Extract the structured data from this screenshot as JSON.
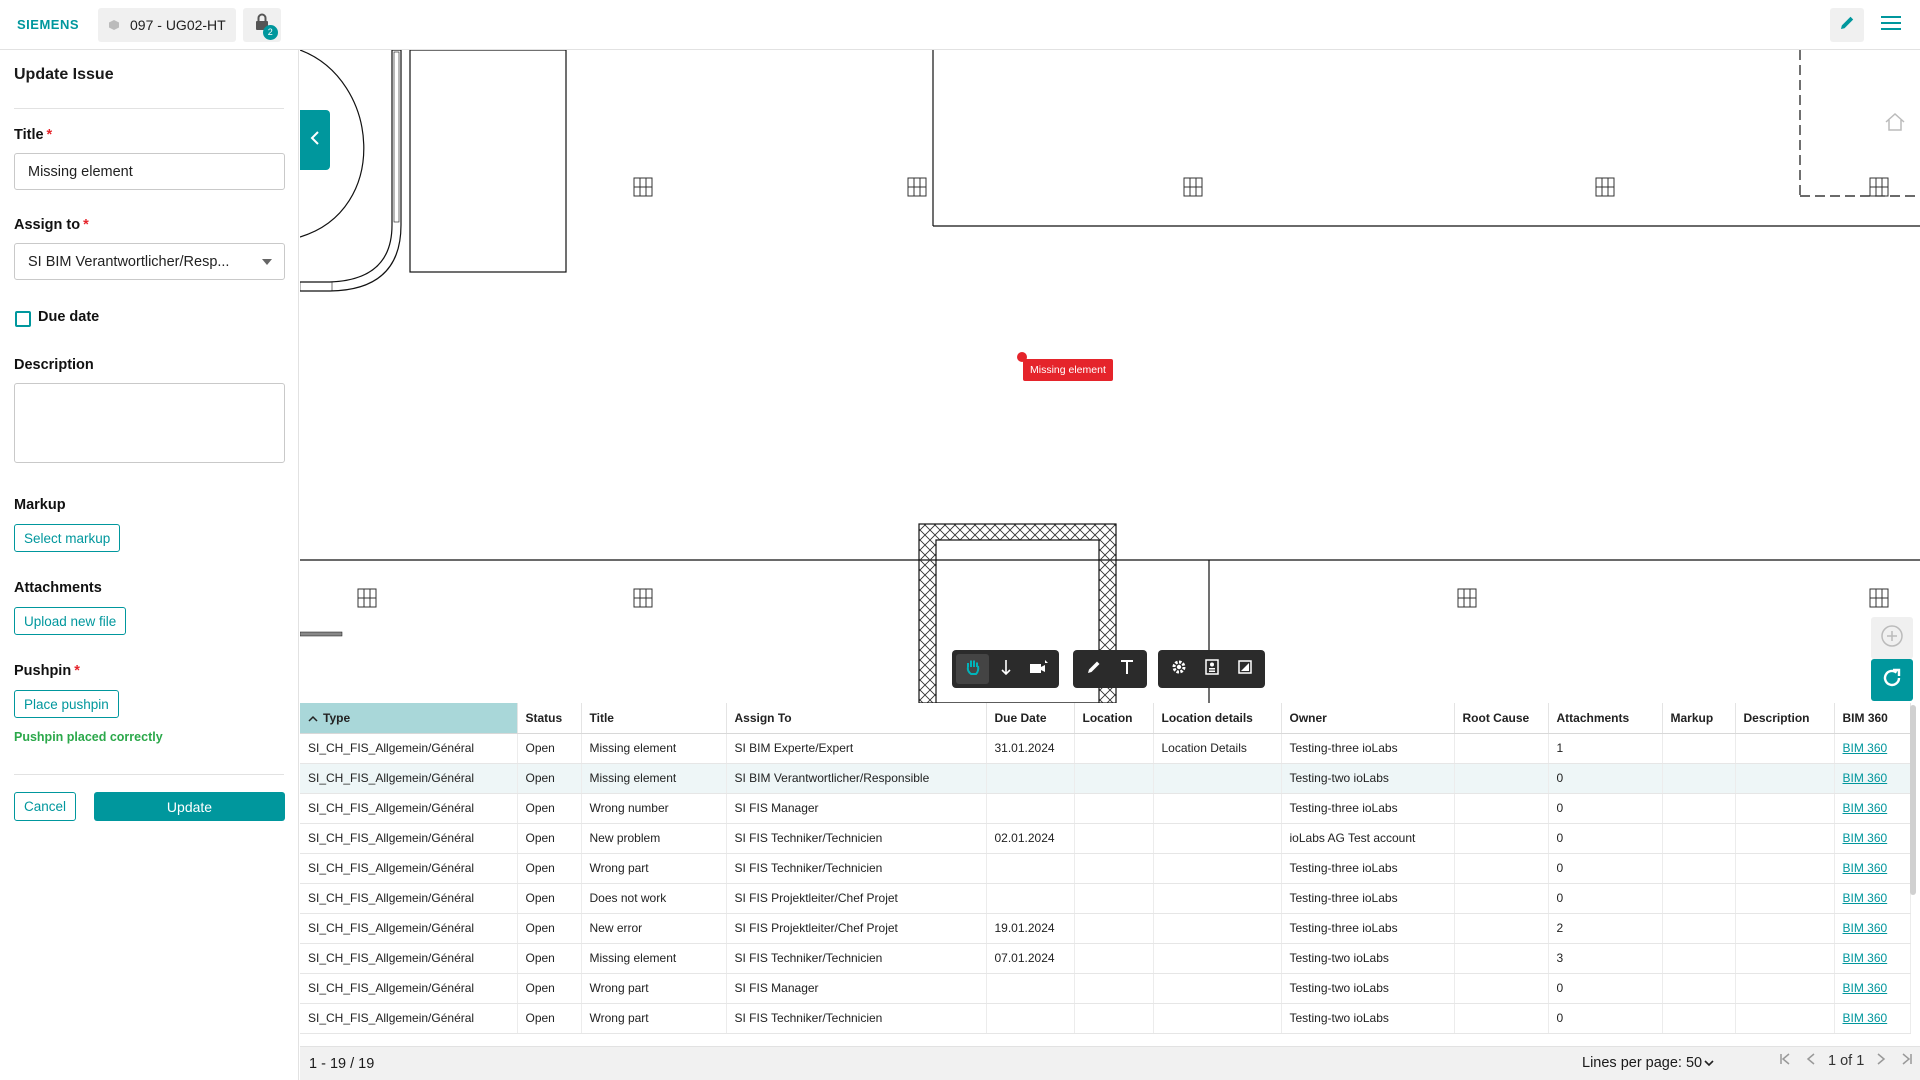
{
  "topbar": {
    "brand": "SIEMENS",
    "model_name": "097 - UG02-HT",
    "lock_badge": "2"
  },
  "panel": {
    "title": "Update Issue",
    "title_label": "Title",
    "title_value": "Missing element",
    "assign_label": "Assign to",
    "assign_value": "SI BIM Verantwortlicher/Resp...",
    "due_date_label": "Due date",
    "description_label": "Description",
    "markup_label": "Markup",
    "select_markup": "Select markup",
    "attachments_label": "Attachments",
    "upload_file": "Upload new file",
    "pushpin_label": "Pushpin",
    "place_pushpin": "Place pushpin",
    "pushpin_status": "Pushpin placed correctly",
    "cancel": "Cancel",
    "update": "Update",
    "required_mark": "*"
  },
  "viewer": {
    "issue_label": "Missing element"
  },
  "table": {
    "columns": [
      "Type",
      "Status",
      "Title",
      "Assign To",
      "Due Date",
      "Location",
      "Location details",
      "Owner",
      "Root Cause",
      "Attachments",
      "Markup",
      "Description",
      "BIM 360"
    ],
    "rows": [
      [
        "SI_CH_FIS_Allgemein/Général",
        "Open",
        "Missing element",
        "SI BIM Experte/Expert",
        "31.01.2024",
        "",
        "Location Details",
        "Testing-three ioLabs",
        "",
        "1",
        "",
        "",
        "BIM 360"
      ],
      [
        "SI_CH_FIS_Allgemein/Général",
        "Open",
        "Missing element",
        "SI BIM Verantwortlicher/Responsible",
        "",
        "",
        "",
        "Testing-two ioLabs",
        "",
        "0",
        "",
        "",
        "BIM 360"
      ],
      [
        "SI_CH_FIS_Allgemein/Général",
        "Open",
        "Wrong number",
        "SI FIS Manager",
        "",
        "",
        "",
        "Testing-three ioLabs",
        "",
        "0",
        "",
        "",
        "BIM 360"
      ],
      [
        "SI_CH_FIS_Allgemein/Général",
        "Open",
        "New problem",
        "SI FIS Techniker/Technicien",
        "02.01.2024",
        "",
        "",
        "ioLabs AG Test account",
        "",
        "0",
        "",
        "",
        "BIM 360"
      ],
      [
        "SI_CH_FIS_Allgemein/Général",
        "Open",
        "Wrong part",
        "SI FIS Techniker/Technicien",
        "",
        "",
        "",
        "Testing-three ioLabs",
        "",
        "0",
        "",
        "",
        "BIM 360"
      ],
      [
        "SI_CH_FIS_Allgemein/Général",
        "Open",
        "Does not work",
        "SI FIS Projektleiter/Chef Projet",
        "",
        "",
        "",
        "Testing-three ioLabs",
        "",
        "0",
        "",
        "",
        "BIM 360"
      ],
      [
        "SI_CH_FIS_Allgemein/Général",
        "Open",
        "New error",
        "SI FIS Projektleiter/Chef Projet",
        "19.01.2024",
        "",
        "",
        "Testing-three ioLabs",
        "",
        "2",
        "",
        "",
        "BIM 360"
      ],
      [
        "SI_CH_FIS_Allgemein/Général",
        "Open",
        "Missing element",
        "SI FIS Techniker/Technicien",
        "07.01.2024",
        "",
        "",
        "Testing-two ioLabs",
        "",
        "3",
        "",
        "",
        "BIM 360"
      ],
      [
        "SI_CH_FIS_Allgemein/Général",
        "Open",
        "Wrong part",
        "SI FIS Manager",
        "",
        "",
        "",
        "Testing-two ioLabs",
        "",
        "0",
        "",
        "",
        "BIM 360"
      ],
      [
        "SI_CH_FIS_Allgemein/Général",
        "Open",
        "Wrong part",
        "SI FIS Techniker/Technicien",
        "",
        "",
        "",
        "Testing-two ioLabs",
        "",
        "0",
        "",
        "",
        "BIM 360"
      ]
    ],
    "selected_row": 1,
    "sorted_column": 0
  },
  "footer": {
    "range": "1 - 19 / 19",
    "lines_per_page": "Lines per page: 50",
    "page": "1 of 1"
  },
  "colors": {
    "accent": "#00979d",
    "issue_red": "#e5242b",
    "success_green": "#2ba84a"
  },
  "icons": [
    "cube-icon",
    "lock-icon",
    "pencil-icon",
    "hamburger-menu-icon",
    "chevron-left-icon",
    "home-icon",
    "hand-pan-icon",
    "walk-icon",
    "camera-icon",
    "markup-pen-icon",
    "text-icon",
    "settings-gear-icon",
    "properties-icon",
    "fullscreen-icon",
    "zoom-in-icon",
    "refresh-icon",
    "sort-up-icon",
    "first-page-icon",
    "prev-page-icon",
    "next-page-icon",
    "last-page-icon"
  ]
}
